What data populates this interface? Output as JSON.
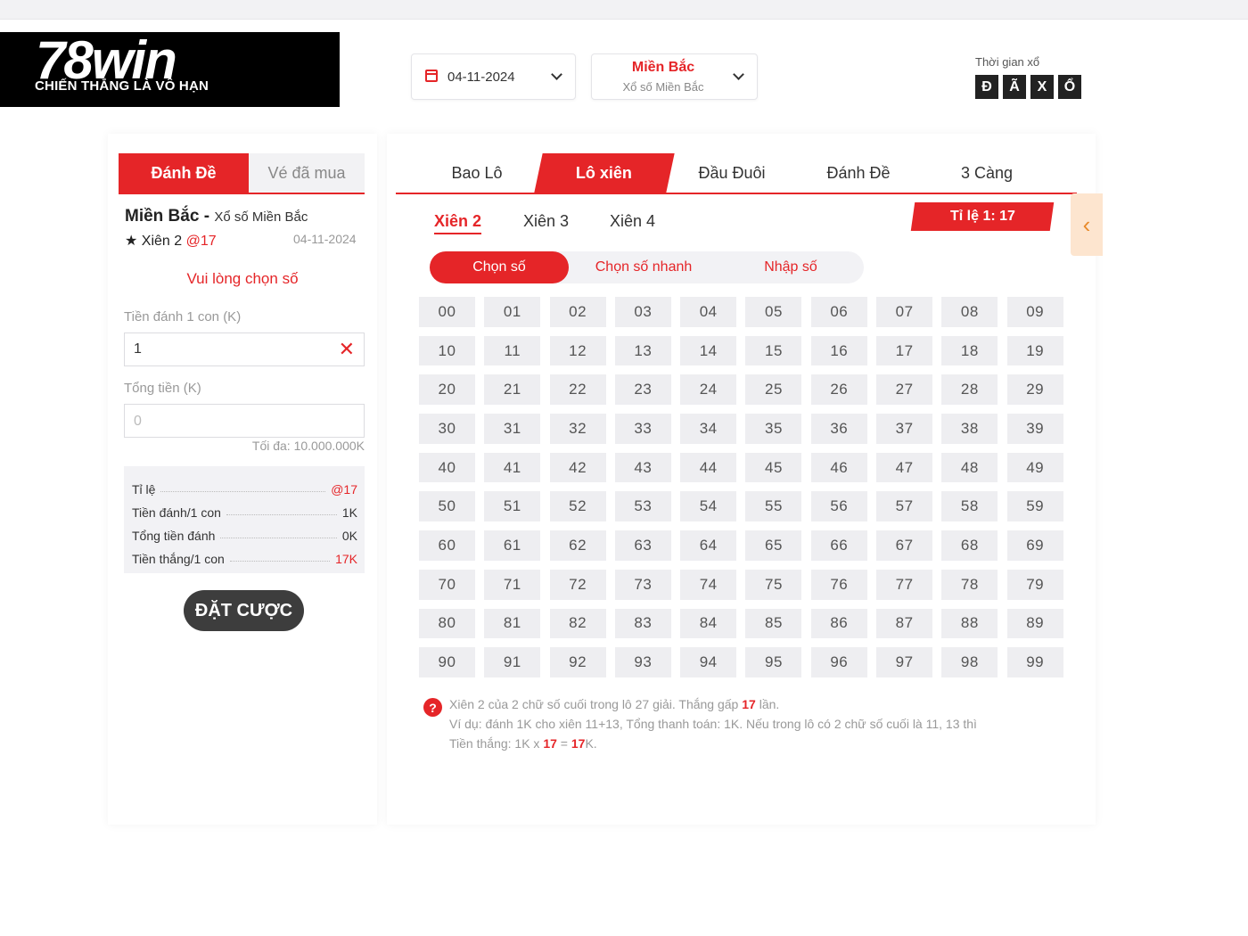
{
  "logo": {
    "brand": "78win",
    "slogan": "CHIẾN THẮNG LÀ VÔ HẠN"
  },
  "header": {
    "date": "04-11-2024",
    "region_title": "Miền Bắc",
    "region_sub": "Xổ số Miền Bắc",
    "draw_time_label": "Thời gian xổ",
    "draw_letters": [
      "Đ",
      "Ã",
      "X",
      "Ổ"
    ]
  },
  "left": {
    "tabs": [
      "Đánh Đề",
      "Vé đã mua"
    ],
    "region": "Miền Bắc",
    "region_sep": " - ",
    "region_sub": "Xổ số Miền Bắc",
    "bet_type": "★ Xiên 2 ",
    "bet_odds": "@17",
    "date": "04-11-2024",
    "please_select": "Vui lòng chọn số",
    "stake_label": "Tiền đánh 1 con (K)",
    "stake_value": "1",
    "total_label": "Tổng tiền (K)",
    "total_placeholder": "0",
    "max_note": "Tối đa: 10.000.000K",
    "summary": [
      {
        "key": "Tỉ lệ",
        "value": "@17",
        "red": true
      },
      {
        "key": "Tiền đánh/1 con",
        "value": "1K",
        "red": false
      },
      {
        "key": "Tổng tiền đánh",
        "value": "0K",
        "red": false
      },
      {
        "key": "Tiền thắng/1 con",
        "value": "17K",
        "red": true
      }
    ],
    "bet_button": "ĐẶT CƯỢC"
  },
  "right": {
    "tabs": [
      "Bao Lô",
      "Lô xiên",
      "Đầu Đuôi",
      "Đánh Đề",
      "3 Càng"
    ],
    "active_tab": 1,
    "subtabs": [
      "Xiên 2",
      "Xiên 3",
      "Xiên 4"
    ],
    "ratio": "Tỉ lệ 1: 17",
    "side_arrow": "‹",
    "modes": [
      "Chọn số",
      "Chọn số nhanh",
      "Nhập số"
    ],
    "numbers": [
      "00",
      "01",
      "02",
      "03",
      "04",
      "05",
      "06",
      "07",
      "08",
      "09",
      "10",
      "11",
      "12",
      "13",
      "14",
      "15",
      "16",
      "17",
      "18",
      "19",
      "20",
      "21",
      "22",
      "23",
      "24",
      "25",
      "26",
      "27",
      "28",
      "29",
      "30",
      "31",
      "32",
      "33",
      "34",
      "35",
      "36",
      "37",
      "38",
      "39",
      "40",
      "41",
      "42",
      "43",
      "44",
      "45",
      "46",
      "47",
      "48",
      "49",
      "50",
      "51",
      "52",
      "53",
      "54",
      "55",
      "56",
      "57",
      "58",
      "59",
      "60",
      "61",
      "62",
      "63",
      "64",
      "65",
      "66",
      "67",
      "68",
      "69",
      "70",
      "71",
      "72",
      "73",
      "74",
      "75",
      "76",
      "77",
      "78",
      "79",
      "80",
      "81",
      "82",
      "83",
      "84",
      "85",
      "86",
      "87",
      "88",
      "89",
      "90",
      "91",
      "92",
      "93",
      "94",
      "95",
      "96",
      "97",
      "98",
      "99"
    ],
    "help": {
      "icon": "?",
      "line1_a": "Xiên 2 của 2 chữ số cuối trong lô 27 giải. Thắng gấp ",
      "line1_b": "17",
      "line1_c": " lần.",
      "line2": "Ví dụ: đánh 1K cho xiên 11+13, Tổng thanh toán: 1K. Nếu trong lô có 2 chữ số cuối là 11, 13 thì",
      "line3_a": "Tiền thắng: 1K x ",
      "line3_b": "17",
      "line3_c": " = ",
      "line3_d": "17",
      "line3_e": "K."
    }
  }
}
